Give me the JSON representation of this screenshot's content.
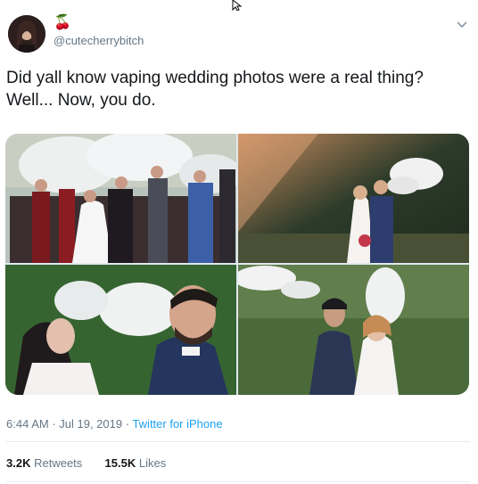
{
  "user": {
    "handle": "@cutecherrybitch",
    "name_emoji": "🍒"
  },
  "tweet": {
    "text": "Did yall know vaping wedding photos were a real thing?\nWell... Now, you do."
  },
  "media": {
    "images": [
      {
        "description": "group-wedding-vape"
      },
      {
        "description": "couple-forest-vape"
      },
      {
        "description": "closeup-bride-groom-vape"
      },
      {
        "description": "couple-park-vape"
      }
    ]
  },
  "meta": {
    "time": "6:44 AM",
    "sep1": " · ",
    "date": "Jul 19, 2019",
    "sep2": " · ",
    "source": "Twitter for iPhone"
  },
  "stats": {
    "retweets_count": "3.2K",
    "retweets_label": "Retweets",
    "likes_count": "15.5K",
    "likes_label": "Likes"
  },
  "icons": {
    "menu": "chevron-down-icon",
    "cursor": "mouse-cursor-icon"
  },
  "colors": {
    "text": "#14171a",
    "secondary": "#657786",
    "link": "#1da1f2",
    "divider": "#e6ecf0"
  }
}
